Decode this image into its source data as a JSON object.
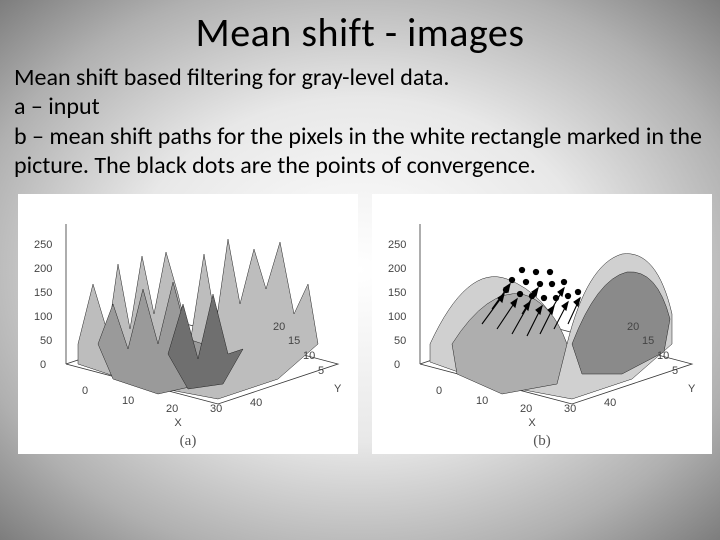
{
  "title": "Mean shift - images",
  "body": {
    "line1": "Mean shift based filtering for gray-level data.",
    "line2": "a – input",
    "line3": "b – mean shift paths for the pixels in the white rectangle marked in the picture. The black dots are the points of convergence."
  },
  "figures": {
    "a": {
      "caption": "(a)",
      "xlabel": "X",
      "ylabel": "Y",
      "z_ticks": [
        "0",
        "50",
        "100",
        "150",
        "200",
        "250"
      ],
      "x_ticks": [
        "0",
        "10",
        "20",
        "30",
        "40"
      ],
      "y_ticks": [
        "5",
        "10",
        "15",
        "20"
      ]
    },
    "b": {
      "caption": "(b)",
      "xlabel": "X",
      "ylabel": "Y",
      "z_ticks": [
        "0",
        "50",
        "100",
        "150",
        "200",
        "250"
      ],
      "x_ticks": [
        "0",
        "10",
        "20",
        "30",
        "40"
      ],
      "y_ticks": [
        "5",
        "10",
        "15",
        "20"
      ]
    }
  },
  "chart_data": [
    {
      "type": "surface",
      "label": "a",
      "title": "input gray-level surface",
      "xlabel": "X",
      "ylabel": "Y",
      "zlabel": "",
      "xlim": [
        0,
        40
      ],
      "ylim": [
        0,
        20
      ],
      "zlim": [
        0,
        250
      ],
      "description": "3D rendered intensity surface of a gray-level image patch. Highly irregular jagged terrain with multiple peaks near z≈200-250 around x≈30-38 and deep valleys near z≈0-50 around x≈20-30. No numeric grid data labelled beyond axis ticks."
    },
    {
      "type": "surface",
      "label": "b",
      "title": "mean shift paths",
      "xlabel": "X",
      "ylabel": "Y",
      "zlabel": "",
      "xlim": [
        0,
        40
      ],
      "ylim": [
        0,
        20
      ],
      "zlim": [
        0,
        250
      ],
      "description": "Smoothed version of (a) after mean-shift filtering; broader plateaus. Overlaid black arrows show mean-shift iteration paths for pixels from a marked white rectangle, and black dots mark their convergence points clustered on two plateaus near z≈150-200.",
      "convergence_points_approx": [
        {
          "x": 12,
          "y": 10,
          "z": 180
        },
        {
          "x": 14,
          "y": 11,
          "z": 180
        },
        {
          "x": 16,
          "y": 12,
          "z": 175
        },
        {
          "x": 18,
          "y": 12,
          "z": 175
        },
        {
          "x": 20,
          "y": 13,
          "z": 170
        },
        {
          "x": 22,
          "y": 14,
          "z": 170
        },
        {
          "x": 24,
          "y": 14,
          "z": 170
        },
        {
          "x": 26,
          "y": 14,
          "z": 165
        },
        {
          "x": 28,
          "y": 12,
          "z": 165
        },
        {
          "x": 26,
          "y": 10,
          "z": 170
        },
        {
          "x": 24,
          "y": 10,
          "z": 170
        },
        {
          "x": 22,
          "y": 10,
          "z": 175
        },
        {
          "x": 20,
          "y": 9,
          "z": 175
        },
        {
          "x": 18,
          "y": 9,
          "z": 180
        }
      ]
    }
  ]
}
